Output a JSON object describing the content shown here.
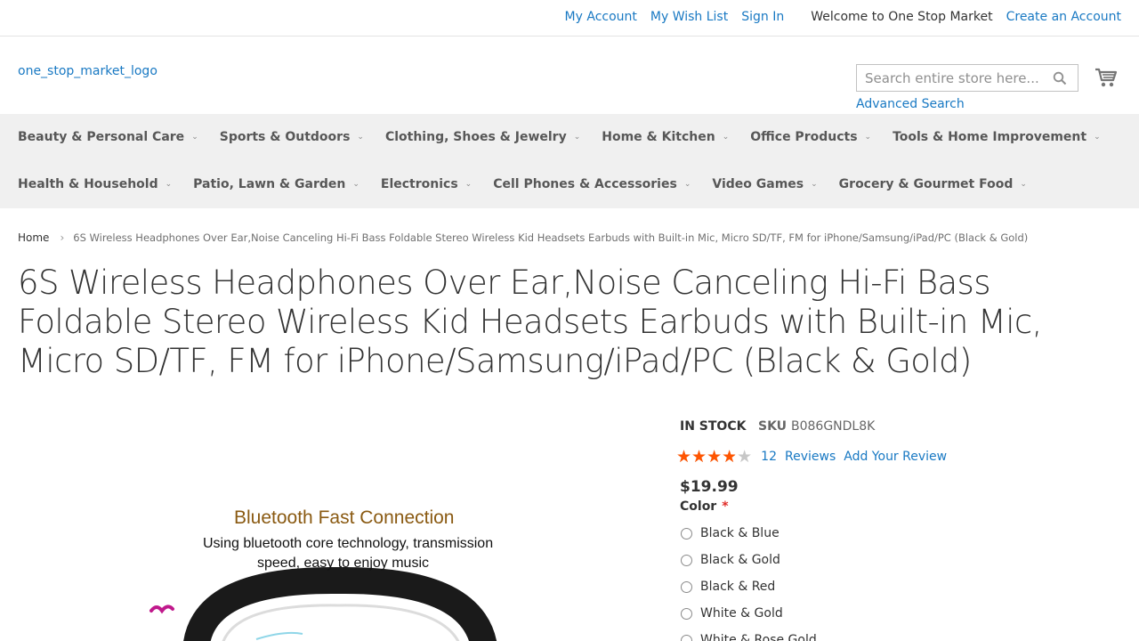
{
  "top_links": {
    "my_account": "My Account",
    "wish_list": "My Wish List",
    "sign_in": "Sign In",
    "welcome": "Welcome to One Stop Market",
    "create_account": "Create an Account"
  },
  "header": {
    "logo_alt": "one_stop_market_logo",
    "search_placeholder": "Search entire store here...",
    "advanced_search": "Advanced Search"
  },
  "nav": {
    "row1": [
      "Beauty & Personal Care",
      "Sports & Outdoors",
      "Clothing, Shoes & Jewelry",
      "Home & Kitchen",
      "Office Products",
      "Tools & Home Improvement"
    ],
    "row2": [
      "Health & Household",
      "Patio, Lawn & Garden",
      "Electronics",
      "Cell Phones & Accessories",
      "Video Games",
      "Grocery & Gourmet Food"
    ]
  },
  "breadcrumb": {
    "home": "Home",
    "current": "6S Wireless Headphones Over Ear,Noise Canceling Hi-Fi Bass Foldable Stereo Wireless Kid Headsets Earbuds with Built-in Mic, Micro SD/TF, FM for iPhone/Samsung/iPad/PC (Black & Gold)"
  },
  "product": {
    "title": "6S Wireless Headphones Over Ear,Noise Canceling Hi-Fi Bass Foldable Stereo Wireless Kid Headsets Earbuds with Built-in Mic, Micro SD/TF, FM for iPhone/Samsung/iPad/PC (Black & Gold)",
    "stock": "IN STOCK",
    "sku_label": "SKU",
    "sku": "B086GNDL8K",
    "rating_fraction": 0.78,
    "review_count": "12",
    "reviews_word": "Reviews",
    "add_review": "Add Your Review",
    "price": "$19.99",
    "color_label": "Color",
    "required_mark": "*",
    "color_options": [
      "Black & Blue",
      "Black & Gold",
      "Black & Red",
      "White & Gold",
      "White & Rose Gold"
    ]
  },
  "image_text": {
    "headline": "Bluetooth Fast Connection",
    "line1": "Using bluetooth core technology, transmission",
    "line2": "speed, easy to enjoy music"
  },
  "colors": {
    "link": "#1979c3",
    "star": "#ff5501",
    "nav_bg": "#f0f0f0",
    "required": "#e02b27"
  }
}
